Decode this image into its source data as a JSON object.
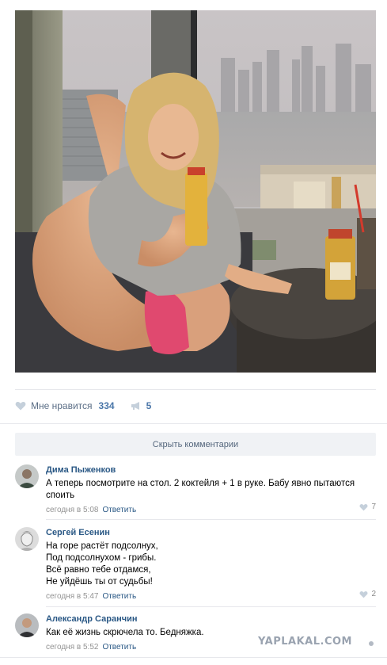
{
  "post": {
    "likes_label": "Мне нравится",
    "likes_count": "334",
    "shares_count": "5",
    "hide_comments_label": "Скрыть комментарии"
  },
  "comments": [
    {
      "author": "Дима Пыженков",
      "text": "А теперь посмотрите на стол. 2 коктейля + 1 в руке. Бабу явно пытаются споить",
      "time": "сегодня в 5:08",
      "reply": "Ответить",
      "likes": "7"
    },
    {
      "author": "Сергей Есенин",
      "text": "На горе растёт подсолнух,\nПод подсолнухом - грибы.\nВсё равно тебе отдамся,\nНе уйдёшь ты от судьбы!",
      "time": "сегодня в 5:47",
      "reply": "Ответить",
      "likes": "2"
    },
    {
      "author": "Александр Саранчин",
      "text": "Как её жизнь скрючела то. Бедняжка.",
      "time": "сегодня в 5:52",
      "reply": "Ответить",
      "likes": ""
    }
  ],
  "watermark": "YAPLAKAL.COM",
  "icons": {
    "like": "heart-icon",
    "share": "megaphone-icon"
  },
  "colors": {
    "link": "#2a5885",
    "meta": "#939393",
    "button_bg": "#f0f2f5"
  }
}
